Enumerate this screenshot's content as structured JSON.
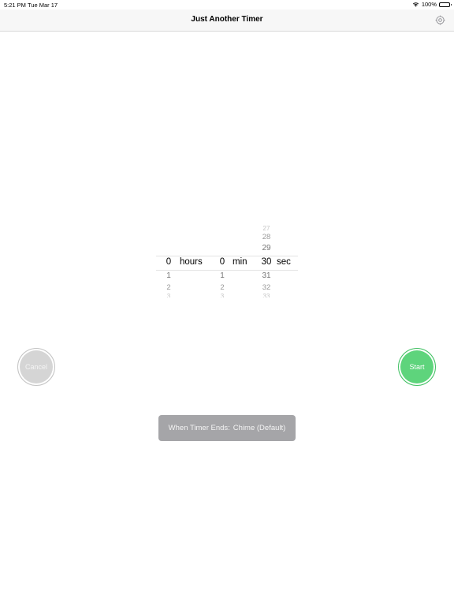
{
  "status_bar": {
    "time": "5:21 PM",
    "date": "Tue Mar 17",
    "battery": "100%"
  },
  "nav": {
    "title": "Just Another Timer",
    "settings_icon": "gear-icon"
  },
  "picker": {
    "hours": {
      "value": "0",
      "unit": "hours",
      "below": [
        "1",
        "2",
        "3"
      ]
    },
    "minutes": {
      "value": "0",
      "unit": "min",
      "below": [
        "1",
        "2",
        "3"
      ]
    },
    "seconds": {
      "value": "30",
      "unit": "sec",
      "above": [
        "27",
        "28",
        "29"
      ],
      "below": [
        "31",
        "32",
        "33"
      ]
    }
  },
  "buttons": {
    "cancel": "Cancel",
    "start": "Start"
  },
  "timer_end": {
    "label": "When Timer Ends:",
    "value": "Chime (Default)"
  },
  "colors": {
    "start": "#5ed47c",
    "cancel": "#d5d5d5",
    "pill": "#a5a5a8",
    "nav_bg": "#f7f7f7"
  }
}
